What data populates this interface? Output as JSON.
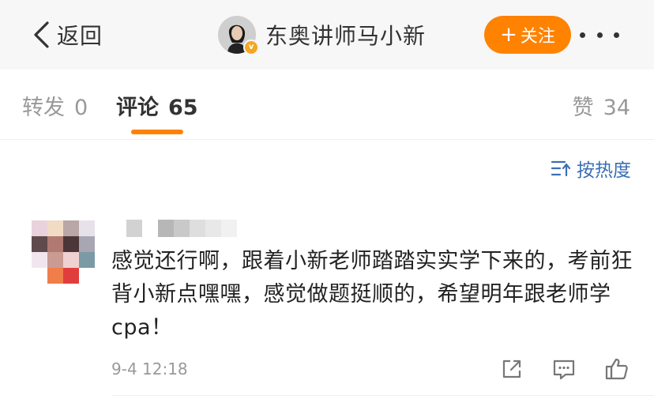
{
  "topbar": {
    "back_label": "返回",
    "username": "东奥讲师马小新",
    "verified_badge": "v",
    "follow_label": "关注",
    "follow_plus": "+",
    "accent_color": "#ff8200"
  },
  "tabs": {
    "repost": {
      "label": "转发",
      "count": "0"
    },
    "comment": {
      "label": "评论",
      "count": "65"
    },
    "like": {
      "label": "赞",
      "count": "34"
    }
  },
  "sort": {
    "label": "按热度",
    "icon": "sort-icon"
  },
  "comment": {
    "text": "感觉还行啊，跟着小新老师踏踏实实学下来的，考前狂背小新点嘿嘿，感觉做题挺顺的，希望明年跟老师学cpa！",
    "time": "9-4 12:18",
    "actions": [
      "share-icon",
      "reply-icon",
      "like-icon"
    ]
  }
}
